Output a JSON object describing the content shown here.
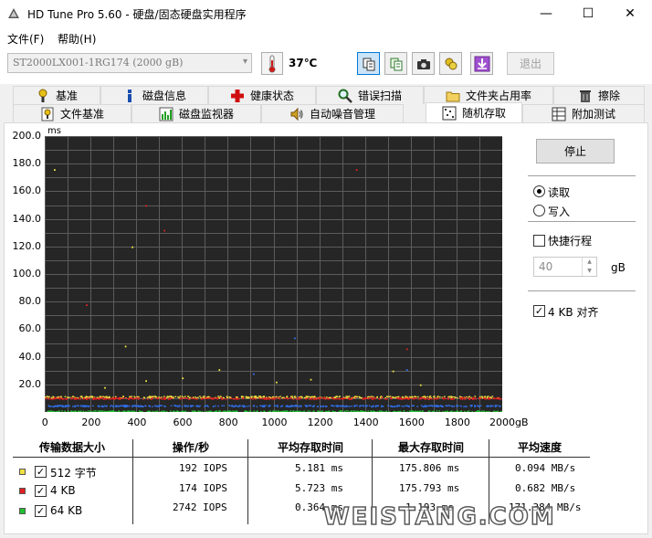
{
  "window": {
    "title": "HD Tune Pro 5.60 - 硬盘/固态硬盘实用程序",
    "minimize_glyph": "—",
    "maximize_glyph": "☐",
    "close_glyph": "✕"
  },
  "menu": {
    "file": "文件(F)",
    "help": "帮助(H)"
  },
  "toolbar": {
    "drive": "ST2000LX001-1RG174 (2000 gB)",
    "temperature": "37℃",
    "exit": "退出",
    "icons": [
      "copy-info-icon",
      "copy-text-icon",
      "screenshot-camera-icon",
      "options-coins-icon",
      "download-arrow-icon"
    ]
  },
  "tabs": {
    "row1": [
      {
        "label": "基准",
        "icon": "benchmark-icon"
      },
      {
        "label": "磁盘信息",
        "icon": "disk-info-icon"
      },
      {
        "label": "健康状态",
        "icon": "health-cross-icon"
      },
      {
        "label": "错误扫描",
        "icon": "magnifier-icon"
      },
      {
        "label": "文件夹占用率",
        "icon": "folder-icon"
      },
      {
        "label": "擦除",
        "icon": "trash-icon"
      }
    ],
    "row2": [
      {
        "label": "文件基准",
        "icon": "file-benchmark-icon"
      },
      {
        "label": "磁盘监视器",
        "icon": "monitor-chart-icon"
      },
      {
        "label": "自动噪音管理",
        "icon": "speaker-icon"
      },
      {
        "label": "随机存取",
        "icon": "random-access-icon",
        "selected": true
      },
      {
        "label": "附加测试",
        "icon": "extra-tests-icon"
      }
    ]
  },
  "chart_data": {
    "type": "scatter",
    "ylabel": "ms",
    "ylim": [
      0,
      200
    ],
    "y_ticks": [
      "200.0",
      "180.0",
      "160.0",
      "140.0",
      "120.0",
      "100.0",
      "80.0",
      "60.0",
      "40.0",
      "20.0"
    ],
    "xlim": [
      0,
      2000
    ],
    "x_ticks": [
      "0",
      "200",
      "400",
      "600",
      "800",
      "1000",
      "1200",
      "1400",
      "1600",
      "1800",
      "2000gB"
    ],
    "grid": true,
    "background": "#262626",
    "series": [
      {
        "name": "512 字节",
        "color": "#f0e040",
        "band": [
          10.5,
          11.8
        ],
        "outliers": [
          [
            40,
            176
          ],
          [
            380,
            120
          ],
          [
            350,
            48
          ],
          [
            1160,
            24
          ],
          [
            440,
            23
          ],
          [
            1640,
            20
          ],
          [
            1010,
            22
          ],
          [
            1520,
            30
          ],
          [
            600,
            25
          ],
          [
            760,
            31
          ],
          [
            260,
            18
          ]
        ]
      },
      {
        "name": "4 KB",
        "color": "#e02020",
        "band": [
          9.6,
          10.8
        ],
        "outliers": [
          [
            1360,
            176
          ],
          [
            440,
            150
          ],
          [
            520,
            132
          ],
          [
            180,
            78
          ],
          [
            1580,
            46
          ]
        ]
      },
      {
        "name": "64 KB",
        "color": "#20c030",
        "band": [
          0.3,
          1.2
        ],
        "outliers": []
      },
      {
        "name": "",
        "color": "#3070f0",
        "band": [
          4.2,
          5.2
        ],
        "outliers": [
          [
            1090,
            54
          ],
          [
            1580,
            31
          ],
          [
            910,
            28
          ]
        ]
      }
    ]
  },
  "controls": {
    "stop": "停止",
    "read": "读取",
    "write": "写入",
    "short_stroke": "快捷行程",
    "short_stroke_value": "40",
    "short_stroke_unit": "gB",
    "align_4kb": "4 KB 对齐"
  },
  "table": {
    "headers": [
      "传输数据大小",
      "操作/秒",
      "平均存取时间",
      "最大存取时间",
      "平均速度"
    ],
    "rows": [
      {
        "color": "#f0e040",
        "size": "512 字节",
        "iops": "192 IOPS",
        "avg": "5.181 ms",
        "max": "175.806 ms",
        "speed": "0.094 MB/s"
      },
      {
        "color": "#e02020",
        "size": "4 KB",
        "iops": "174 IOPS",
        "avg": "5.723 ms",
        "max": "175.793 ms",
        "speed": "0.682 MB/s"
      },
      {
        "color": "#20c030",
        "size": "64 KB",
        "iops": "2742 IOPS",
        "avg": "0.364 ms",
        "max": "1.193 ms",
        "speed": "171.384 MB/s"
      }
    ]
  },
  "watermark": "WEISTANG.COM"
}
